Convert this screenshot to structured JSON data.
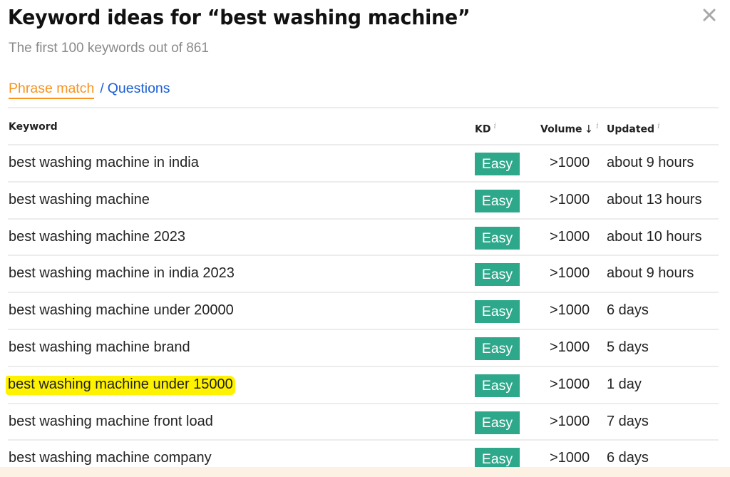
{
  "header": {
    "title": "Keyword ideas for “best washing machine”",
    "subtitle": "The first 100 keywords out of 861",
    "close_icon": "close-icon"
  },
  "tabs": [
    {
      "label": "Phrase match",
      "active": true
    },
    {
      "label": "Questions",
      "active": false
    }
  ],
  "tab_separator": "/",
  "table": {
    "columns": {
      "keyword": "Keyword",
      "kd": "KD",
      "volume": "Volume",
      "volume_sort": "↓",
      "updated": "Updated",
      "info": "i"
    },
    "rows": [
      {
        "keyword": "best washing machine in india",
        "kd": "Easy",
        "volume": ">1000",
        "updated": "about 9 hours",
        "highlighted": false
      },
      {
        "keyword": "best washing machine",
        "kd": "Easy",
        "volume": ">1000",
        "updated": "about 13 hours",
        "highlighted": false
      },
      {
        "keyword": "best washing machine 2023",
        "kd": "Easy",
        "volume": ">1000",
        "updated": "about 10 hours",
        "highlighted": false
      },
      {
        "keyword": "best washing machine in india 2023",
        "kd": "Easy",
        "volume": ">1000",
        "updated": "about 9 hours",
        "highlighted": false
      },
      {
        "keyword": "best washing machine under 20000",
        "kd": "Easy",
        "volume": ">1000",
        "updated": "6 days",
        "highlighted": false
      },
      {
        "keyword": "best washing machine brand",
        "kd": "Easy",
        "volume": ">1000",
        "updated": "5 days",
        "highlighted": false
      },
      {
        "keyword": "best washing machine under 15000",
        "kd": "Easy",
        "volume": ">1000",
        "updated": "1 day",
        "highlighted": true
      },
      {
        "keyword": "best washing machine front load",
        "kd": "Easy",
        "volume": ">1000",
        "updated": "7 days",
        "highlighted": false
      },
      {
        "keyword": "best washing machine company",
        "kd": "Easy",
        "volume": ">1000",
        "updated": "6 days",
        "highlighted": false
      }
    ]
  },
  "colors": {
    "tab_active": "#f7931e",
    "tab_link": "#1a5fd6",
    "kd_easy": "#2ea88b",
    "highlight": "#fff200"
  }
}
